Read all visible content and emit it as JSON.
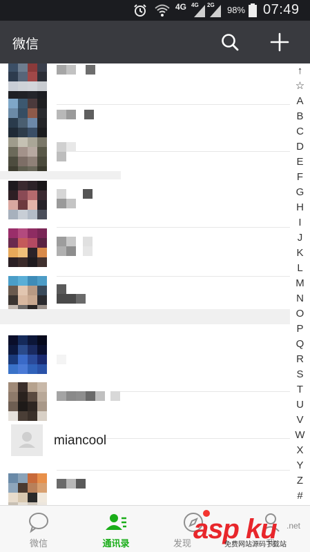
{
  "status_bar": {
    "network_1": "4G",
    "network_2": "4G",
    "network_3": "2G",
    "battery": "98%",
    "time": "07:49"
  },
  "title_bar": {
    "title": "微信",
    "search_icon": "search-icon",
    "add_icon": "plus-icon"
  },
  "contacts": {
    "visible_named_contact": "miancool"
  },
  "index": {
    "letters": [
      "↑",
      "☆",
      "A",
      "B",
      "C",
      "D",
      "E",
      "F",
      "G",
      "H",
      "I",
      "J",
      "K",
      "L",
      "M",
      "N",
      "O",
      "P",
      "Q",
      "R",
      "S",
      "T",
      "U",
      "V",
      "W",
      "X",
      "Y",
      "Z",
      "#"
    ]
  },
  "tabs": [
    {
      "label": "微信",
      "icon": "chat-icon",
      "active": false
    },
    {
      "label": "通讯录",
      "icon": "contacts-icon",
      "active": true
    },
    {
      "label": "发现",
      "icon": "compass-icon",
      "active": false
    },
    {
      "label": "我",
      "icon": "me-icon",
      "active": false
    }
  ],
  "watermark": {
    "logo": "asp ku",
    "suffix": ".net",
    "tagline": "免费网站源码下载站"
  },
  "colors": {
    "status_bar_bg": "#1b1c20",
    "title_bar_bg": "#393a3f",
    "active_tab": "#1aad19",
    "badge": "#f43530"
  }
}
